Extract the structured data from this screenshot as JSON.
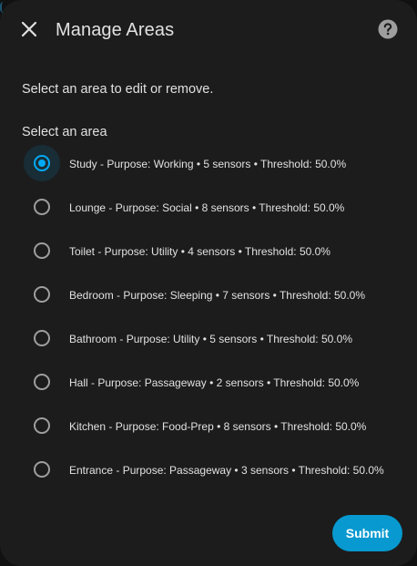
{
  "dialog": {
    "title": "Manage Areas",
    "close_icon": "close-icon",
    "help_icon": "help-circle-icon",
    "description": "Select an area to edit or remove.",
    "group_label": "Select an area",
    "options": [
      {
        "label": "Study - Purpose: Working • 5 sensors • Threshold: 50.0%",
        "selected": true
      },
      {
        "label": "Lounge - Purpose: Social • 8 sensors • Threshold: 50.0%",
        "selected": false
      },
      {
        "label": "Toilet - Purpose: Utility • 4 sensors • Threshold: 50.0%",
        "selected": false
      },
      {
        "label": "Bedroom - Purpose: Sleeping • 7 sensors • Threshold: 50.0%",
        "selected": false
      },
      {
        "label": "Bathroom - Purpose: Utility • 5 sensors • Threshold: 50.0%",
        "selected": false
      },
      {
        "label": "Hall - Purpose: Passageway • 2 sensors • Threshold: 50.0%",
        "selected": false
      },
      {
        "label": "Kitchen - Purpose: Food-Prep • 8 sensors • Threshold: 50.0%",
        "selected": false
      },
      {
        "label": "Entrance - Purpose: Passageway • 3 sensors • Threshold: 50.0%",
        "selected": false
      }
    ],
    "submit_label": "Submit"
  },
  "colors": {
    "dialog_bg": "#1c1c1c",
    "accent": "#03a9f4",
    "button_bg": "#0799cf",
    "text": "#e1e1e1",
    "radio_border": "#9e9e9e"
  }
}
